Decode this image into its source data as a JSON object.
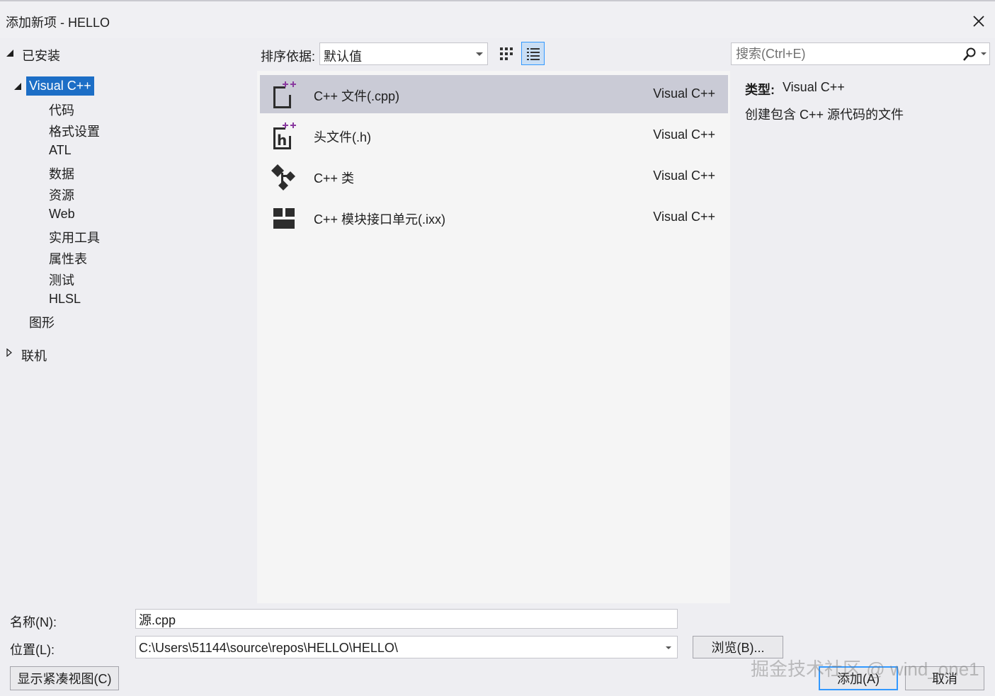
{
  "window": {
    "title": "添加新项 - HELLO",
    "close_icon": "close-icon"
  },
  "tree": {
    "installed": "已安装",
    "visual_cpp": "Visual C++",
    "children": [
      "代码",
      "格式设置",
      "ATL",
      "数据",
      "资源",
      "Web",
      "实用工具",
      "属性表",
      "测试",
      "HLSL"
    ],
    "graphics": "图形",
    "online": "联机"
  },
  "toolbar": {
    "sort_label": "排序依据:",
    "sort_value": "默认值",
    "search_placeholder": "搜索(Ctrl+E)"
  },
  "items": [
    {
      "name": "C++ 文件(.cpp)",
      "type": "Visual C++",
      "icon": "cpp-file-icon",
      "selected": true
    },
    {
      "name": "头文件(.h)",
      "type": "Visual C++",
      "icon": "header-file-icon",
      "selected": false
    },
    {
      "name": "C++ 类",
      "type": "Visual C++",
      "icon": "cpp-class-icon",
      "selected": false
    },
    {
      "name": "C++ 模块接口单元(.ixx)",
      "type": "Visual C++",
      "icon": "module-interface-icon",
      "selected": false
    }
  ],
  "details": {
    "type_label": "类型:",
    "type_value": "Visual C++",
    "description": "创建包含 C++ 源代码的文件"
  },
  "bottom": {
    "name_label": "名称(N):",
    "name_value": "源.cpp",
    "location_label": "位置(L):",
    "location_value": "C:\\Users\\51144\\source\\repos\\HELLO\\HELLO\\",
    "browse_label": "浏览(B)...",
    "compact_label": "显示紧凑视图(C)",
    "add_label": "添加(A)",
    "cancel_label": "取消"
  },
  "watermark": "掘金技术社区 @ wind_one1",
  "colors": {
    "selection_blue": "#1c6ec6",
    "list_selected": "#cacbd6",
    "accent": "#3399ff",
    "icon_purple": "#8a3aa0"
  }
}
